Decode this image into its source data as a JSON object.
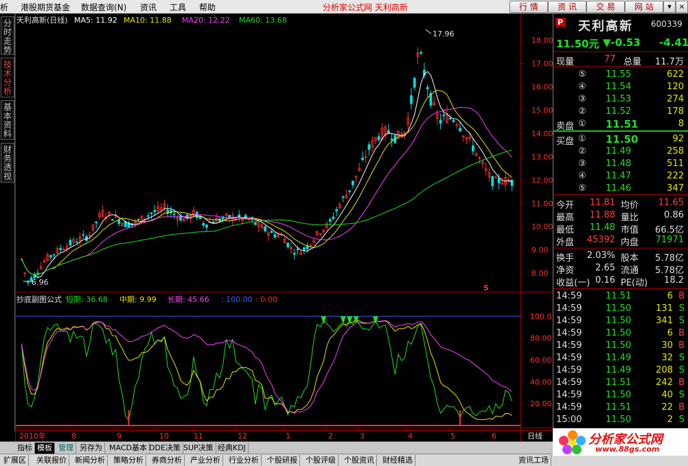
{
  "menu": {
    "items": [
      "析",
      "港股期货基金",
      "数据查询(N)",
      "资讯",
      "工具",
      "帮助"
    ],
    "site_title": "分析家公式网  天利高新",
    "buttons": [
      "行 情",
      "资 讯",
      "交 易",
      "网 站"
    ],
    "window_controls": [
      "▾",
      "×"
    ]
  },
  "left_tabs": [
    "分时走势",
    "技术分析",
    "基本资料",
    "财务透视"
  ],
  "main_chart": {
    "title": "天利高新(日线)",
    "ma_labels": [
      {
        "text": "MA5: 11.92",
        "color": "#ffffff"
      },
      {
        "text": "MA10: 11.88",
        "color": "#e8e800"
      },
      {
        "text": "MA20: 12.22",
        "color": "#ff40ff"
      },
      {
        "text": "MA60: 13.68",
        "color": "#20e020"
      }
    ],
    "high_marker": "17.96",
    "low_marker": "6.96",
    "s_marker": "S"
  },
  "chart_data": [
    {
      "type": "candlestick",
      "title": "天利高新(日线)",
      "ylim": [
        7.3,
        18.6
      ],
      "y_ticks": [
        "18.00",
        "17.00",
        "16.00",
        "15.00",
        "14.00",
        "13.00",
        "12.00",
        "11.00",
        "10.00",
        "9.00",
        "8.00"
      ],
      "x_ticks": [
        "2010年",
        "8",
        "9",
        "10",
        "11",
        "12",
        "1",
        "2",
        "3",
        "4",
        "5",
        "6"
      ],
      "x_scale_label": "日线",
      "series": [
        {
          "name": "MA5",
          "color": "#ffffff",
          "last": 11.92
        },
        {
          "name": "MA10",
          "color": "#e8e800",
          "last": 11.88
        },
        {
          "name": "MA20",
          "color": "#ff40ff",
          "last": 12.22
        },
        {
          "name": "MA60",
          "color": "#20e020",
          "last": 13.68
        }
      ],
      "annotations": [
        "17.96",
        "6.96"
      ]
    },
    {
      "type": "line",
      "title": "抄底副图公式",
      "ylim": [
        0,
        110
      ],
      "y_ticks": [
        "100.0",
        "80.00",
        "60.00",
        "40.00",
        "20.00"
      ],
      "series": [
        {
          "name": "短期",
          "color": "#20e020",
          "last": 36.68
        },
        {
          "name": "中期",
          "color": "#e8e800",
          "last": 9.99
        },
        {
          "name": "长期",
          "color": "#ff40ff",
          "last": 45.66
        }
      ],
      "reference_lines": [
        {
          "value": 100.0,
          "label": "100.00",
          "color": "#4060ff"
        },
        {
          "value": 0.0,
          "label": "0.00",
          "color": "#ff3030"
        }
      ]
    }
  ],
  "indicator": {
    "name": "抄底副图公式",
    "short_label": "短期: 36.68",
    "mid_label": "中期: 9.99",
    "long_label": "长期: 45.66",
    "ref_label": ": 100.00",
    "zero_label": ": 0.00"
  },
  "quote": {
    "badge": "P",
    "name": "天利高新",
    "code": "600339",
    "price": "11.50元",
    "change": "▼-0.53",
    "pct": "-4.41",
    "current_vol_label": "现量",
    "current_vol": "77",
    "total_vol_label": "总量",
    "total_vol": "11.7万",
    "asks": [
      {
        "level": "⑤",
        "price": "11.55",
        "vol": "622"
      },
      {
        "level": "④",
        "price": "11.54",
        "vol": "120"
      },
      {
        "level": "③",
        "price": "11.53",
        "vol": "274"
      },
      {
        "level": "②",
        "price": "11.52",
        "vol": "178"
      },
      {
        "level": "①",
        "price": "11.51",
        "vol": "8",
        "label": "卖盘"
      }
    ],
    "bids": [
      {
        "level": "①",
        "price": "11.50",
        "vol": "92",
        "label": "买盘"
      },
      {
        "level": "②",
        "price": "11.49",
        "vol": "258"
      },
      {
        "level": "③",
        "price": "11.48",
        "vol": "511"
      },
      {
        "level": "④",
        "price": "11.47",
        "vol": "222"
      },
      {
        "level": "⑤",
        "price": "11.46",
        "vol": "347"
      }
    ],
    "stats": [
      {
        "l1": "今开",
        "v1": "11.81",
        "c1": "r",
        "l2": "均价",
        "v2": "11.65",
        "c2": "r"
      },
      {
        "l1": "最高",
        "v1": "11.88",
        "c1": "r",
        "l2": "量比",
        "v2": "0.86",
        "c2": "w"
      },
      {
        "l1": "最低",
        "v1": "11.48",
        "c1": "g",
        "l2": "市值",
        "v2": "66.5亿",
        "c2": "w"
      },
      {
        "l1": "外盘",
        "v1": "45392",
        "c1": "r",
        "l2": "内盘",
        "v2": "71971",
        "c2": "g"
      }
    ],
    "stats2": [
      {
        "l1": "换手",
        "v1": "2.03%",
        "l2": "股本",
        "v2": "5.78亿"
      },
      {
        "l1": "净资",
        "v1": "2.65",
        "l2": "流通",
        "v2": "5.78亿"
      },
      {
        "l1": "收益(一)",
        "v1": "0.16",
        "l2": "PE(动)",
        "v2": "18.2"
      }
    ],
    "ticks": [
      {
        "time": "14:59",
        "price": "11.51",
        "vol": "6",
        "side": "B"
      },
      {
        "time": "14:59",
        "price": "11.50",
        "vol": "131",
        "side": "S"
      },
      {
        "time": "14:59",
        "price": "11.50",
        "vol": "341",
        "side": "S"
      },
      {
        "time": "14:59",
        "price": "11.50",
        "vol": "6",
        "side": "B"
      },
      {
        "time": "14:59",
        "price": "11.50",
        "vol": "30",
        "side": "B"
      },
      {
        "time": "14:59",
        "price": "11.49",
        "vol": "32",
        "side": "S"
      },
      {
        "time": "14:59",
        "price": "11.49",
        "vol": "208",
        "side": "S"
      },
      {
        "time": "14:59",
        "price": "11.51",
        "vol": "242",
        "side": "B"
      },
      {
        "time": "14:59",
        "price": "11.50",
        "vol": "40",
        "side": "S"
      },
      {
        "time": "14:59",
        "price": "11.51",
        "vol": "22",
        "side": "B"
      },
      {
        "time": "15:00",
        "price": "11.50",
        "vol": "2",
        "side": "S"
      }
    ]
  },
  "tabs": [
    "指标",
    "模板",
    "管理",
    "另存为",
    "MACD基本",
    "DDE决策",
    "SUP决策",
    "经典KDJ"
  ],
  "func_bar": [
    "扩展区",
    "关联报价",
    "新闻分析",
    "策略分析",
    "券商分析",
    "产业分析",
    "行业分析",
    "个股研报",
    "个股评级",
    "个股资讯",
    "财经精选",
    "资讯工场"
  ],
  "logo": {
    "text": "分析家公式网",
    "url": "www.88gs.com"
  },
  "colors": {
    "up": "#ff3030",
    "down": "#00e0e0",
    "ma5": "#ffffff",
    "ma10": "#e8e800",
    "ma20": "#ff40ff",
    "ma60": "#20e020"
  }
}
